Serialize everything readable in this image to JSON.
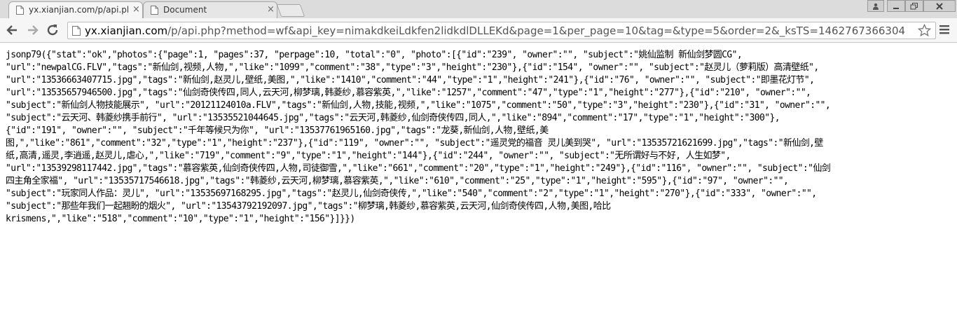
{
  "browser": {
    "tabs": [
      {
        "title": "yx.xianjian.com/p/api.pl",
        "close_glyph": "×",
        "active": true
      },
      {
        "title": "Document",
        "close_glyph": "×",
        "active": false
      }
    ],
    "address": {
      "host": "yx.xianjian.com",
      "path": "/p/api.php?method=wf&api_key=nimakdkeiLdkfen2lidkdlDLLEKd&page=1&per_page=10&tag=&type=5&order=2&_ksTS=1462767366304"
    },
    "icons": {
      "back": "back-arrow-icon",
      "forward": "forward-arrow-icon",
      "reload": "reload-icon",
      "page": "page-icon",
      "star": "star-icon",
      "menu": "hamburger-menu-icon"
    }
  },
  "content": {
    "lines": [
      "jsonp79({\"stat\":\"ok\",\"photos\":{\"page\":1, \"pages\":37, \"perpage\":10, \"total\":\"0\", \"photo\":[{\"id\":\"239\", \"owner\":\"\", \"subject\":\"姚仙监制 新仙剑梦圆CG\",",
      "\"url\":\"newpalCG.FLV\",\"tags\":\"新仙剑,视频,人物,\",\"like\":\"1099\",\"comment\":\"38\",\"type\":\"3\",\"height\":\"230\"},{\"id\":\"154\", \"owner\":\"\", \"subject\":\"赵灵儿（萝莉版）高清壁纸\",",
      "\"url\":\"13536663407715.jpg\",\"tags\":\"新仙剑,赵灵儿,壁纸,美图,\",\"like\":\"1410\",\"comment\":\"44\",\"type\":\"1\",\"height\":\"241\"},{\"id\":\"76\", \"owner\":\"\", \"subject\":\"即墨花灯节\",",
      "\"url\":\"13535657946500.jpg\",\"tags\":\"仙剑奇侠传四,同人,云天河,柳梦璃,韩菱纱,慕容紫英,\",\"like\":\"1257\",\"comment\":\"47\",\"type\":\"1\",\"height\":\"277\"},{\"id\":\"210\", \"owner\":\"\",",
      "\"subject\":\"新仙剑人物技能展示\", \"url\":\"20121124010a.FLV\",\"tags\":\"新仙剑,人物,技能,视频,\",\"like\":\"1075\",\"comment\":\"50\",\"type\":\"3\",\"height\":\"230\"},{\"id\":\"31\", \"owner\":\"\",",
      "\"subject\":\"云天河、韩菱纱携手前行\", \"url\":\"13535521044645.jpg\",\"tags\":\"云天河,韩菱纱,仙剑奇侠传四,同人,\",\"like\":\"894\",\"comment\":\"17\",\"type\":\"1\",\"height\":\"300\"},",
      "{\"id\":\"191\", \"owner\":\"\", \"subject\":\"千年等候只为你\", \"url\":\"13537761965160.jpg\",\"tags\":\"龙葵,新仙剑,人物,壁纸,美",
      "图,\",\"like\":\"861\",\"comment\":\"32\",\"type\":\"1\",\"height\":\"237\"},{\"id\":\"119\", \"owner\":\"\", \"subject\":\"遥灵党的福音 灵儿美到哭\", \"url\":\"13535721621699.jpg\",\"tags\":\"新仙剑,壁",
      "纸,高清,遥灵,李逍遥,赵灵儿,虐心,\",\"like\":\"719\",\"comment\":\"9\",\"type\":\"1\",\"height\":\"144\"},{\"id\":\"244\", \"owner\":\"\", \"subject\":\"无所谓好与不好, 人生如梦\",",
      "\"url\":\"13539298117442.jpg\",\"tags\":\"慕容紫英,仙剑奇侠传四,人物,司徒御雪,\",\"like\":\"661\",\"comment\":\"20\",\"type\":\"1\",\"height\":\"249\"},{\"id\":\"116\", \"owner\":\"\", \"subject\":\"仙剑",
      "四主角全家福\", \"url\":\"13535717546618.jpg\",\"tags\":\"韩菱纱,云天河,柳梦璃,慕容紫英,\",\"like\":\"610\",\"comment\":\"25\",\"type\":\"1\",\"height\":\"595\"},{\"id\":\"97\", \"owner\":\"\",",
      "\"subject\":\"玩家同人作品：灵儿\", \"url\":\"13535697168295.jpg\",\"tags\":\"赵灵儿,仙剑奇侠传,\",\"like\":\"540\",\"comment\":\"2\",\"type\":\"1\",\"height\":\"270\"},{\"id\":\"333\", \"owner\":\"\",",
      "\"subject\":\"那些年我们一起翘盼的烟火\", \"url\":\"13543792192097.jpg\",\"tags\":\"柳梦璃,韩菱纱,慕容紫英,云天河,仙剑奇侠传四,人物,美图,哈比",
      "krismens,\",\"like\":\"518\",\"comment\":\"10\",\"type\":\"1\",\"height\":\"156\"}]}})"
    ]
  }
}
